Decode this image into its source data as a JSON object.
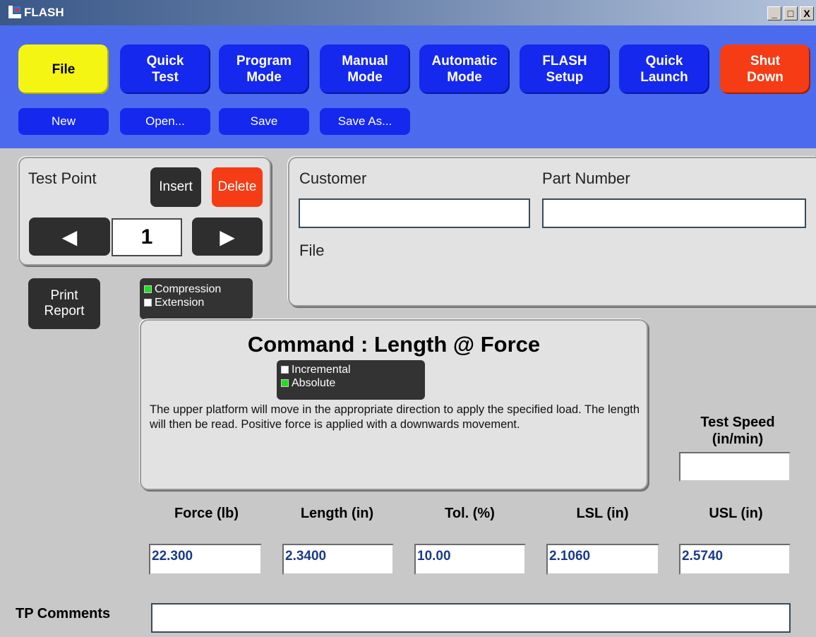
{
  "window": {
    "title": "FLASH",
    "controls": [
      "_",
      "□",
      "X"
    ]
  },
  "menu": {
    "main": [
      {
        "label": "File",
        "style": "yellow"
      },
      {
        "label": "Quick\nTest",
        "style": "blue"
      },
      {
        "label": "Program\nMode",
        "style": "blue"
      },
      {
        "label": "Manual\nMode",
        "style": "blue"
      },
      {
        "label": "Automatic\nMode",
        "style": "blue"
      },
      {
        "label": "FLASH\nSetup",
        "style": "blue"
      },
      {
        "label": "Quick\nLaunch",
        "style": "blue"
      },
      {
        "label": "Shut\nDown",
        "style": "red"
      }
    ],
    "sub": [
      "New",
      "Open...",
      "Save",
      "Save As..."
    ]
  },
  "test_point": {
    "label": "Test Point",
    "insert_label": "Insert",
    "delete_label": "Delete",
    "value": "1",
    "prev_glyph": "◀",
    "next_glyph": "▶"
  },
  "info": {
    "customer_label": "Customer",
    "customer_value": "",
    "part_number_label": "Part Number",
    "part_number_value": "",
    "file_label": "File",
    "file_value": ""
  },
  "print_report_label": "Print\nReport",
  "direction": {
    "options": [
      {
        "label": "Compression",
        "selected": true
      },
      {
        "label": "Extension",
        "selected": false
      }
    ]
  },
  "command": {
    "title": "Command : Length @ Force",
    "mode_options": [
      {
        "label": "Incremental",
        "selected": false
      },
      {
        "label": "Absolute",
        "selected": true
      }
    ],
    "description": "The upper platform will move in the appropriate direction to apply the specified load.  The length will then be read.  Positive force is applied with a downwards movement."
  },
  "test_speed": {
    "label": "Test Speed\n(in/min)",
    "value": ""
  },
  "params": {
    "force_label": "Force (lb)",
    "force_value": "22.300",
    "length_label": "Length (in)",
    "length_value": "2.3400",
    "tol_label": "Tol. (%)",
    "tol_value": "10.00",
    "lsl_label": "LSL (in)",
    "lsl_value": "2.1060",
    "usl_label": "USL (in)",
    "usl_value": "2.5740"
  },
  "tp_comments": {
    "label": "TP Comments",
    "value": ""
  },
  "colors": {
    "menu_blue": "#1428ee",
    "file_yellow": "#f5f514",
    "shutdown_red": "#f53c14",
    "delete_red": "#f53c14",
    "led_green": "#22dd22",
    "led_white": "#ffffff",
    "field_text": "#1a3b8a"
  }
}
